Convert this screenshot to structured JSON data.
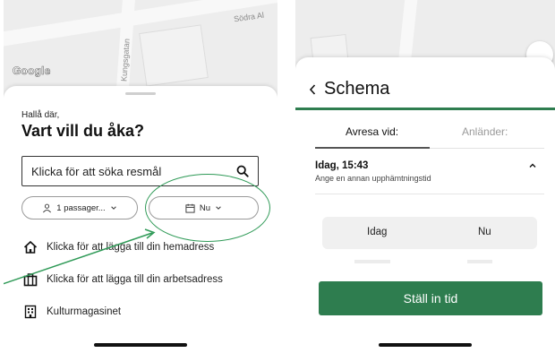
{
  "left": {
    "map": {
      "street_top": "Södra Al",
      "street_vertical": "Kungsgatan",
      "logo": "Google"
    },
    "greeting": "Hallå där,",
    "headline": "Vart vill du åka?",
    "search": {
      "placeholder": "Klicka för att söka resmål"
    },
    "passenger_pill": "1 passager...",
    "time_pill": "Nu",
    "rows": [
      {
        "icon": "home-icon",
        "label": "Klicka för att lägga till din hemadress"
      },
      {
        "icon": "briefcase-icon",
        "label": "Klicka för att lägga till din arbetsadress"
      },
      {
        "icon": "building-icon",
        "label": "Kulturmagasinet"
      }
    ],
    "highlight_color": "#2f9a57"
  },
  "right": {
    "title": "Schema",
    "tabs": [
      "Avresa vid:",
      "Anländer:"
    ],
    "selected_tab": 0,
    "date_line": "Idag, 15:43",
    "date_sub": "Ange en annan upphämtningstid",
    "picker": {
      "day": "Idag",
      "time": "Nu"
    },
    "button": "Ställ in tid",
    "accent": "#2e7d4f"
  }
}
